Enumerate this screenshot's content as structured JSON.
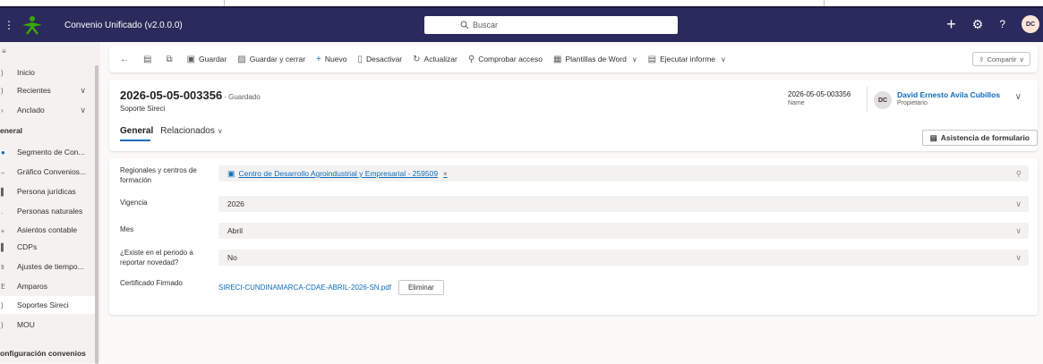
{
  "app": {
    "title": "Convenio Unificado (v2.0.0.0)",
    "search_placeholder": "Buscar",
    "avatar_initials": "DC",
    "colors": {
      "topbar": "#2b2a5c",
      "accent": "#0f6cbd"
    }
  },
  "sidebar": {
    "items": [
      {
        "label": "Inicio"
      },
      {
        "label": "Recientes"
      },
      {
        "label": "Anclado"
      },
      {
        "label": "eneral"
      },
      {
        "label": "Segmento de Con..."
      },
      {
        "label": "Gráfico Convenios..."
      },
      {
        "label": "Persona jurídicas"
      },
      {
        "label": "Personas naturales"
      },
      {
        "label": "Asientos contable"
      },
      {
        "label": "CDPs"
      },
      {
        "label": "Ajustes de tiempo..."
      },
      {
        "label": "Amparos"
      },
      {
        "label": "Soportes Sireci"
      },
      {
        "label": "MOU"
      },
      {
        "label": "onfiguración convenios"
      }
    ]
  },
  "commands": {
    "save": "Guardar",
    "save_close": "Guardar y cerrar",
    "new": "Nuevo",
    "deactivate": "Desactivar",
    "refresh": "Actualizar",
    "check_access": "Comprobar acceso",
    "word_templates": "Plantillas de Word",
    "run_report": "Ejecutar informe",
    "share": "Compartir"
  },
  "record": {
    "title": "2026-05-05-003356",
    "status": "- Guardado",
    "entity": "Soporte Sireci",
    "name_value": "2026-05-05-003356",
    "name_label": "Name",
    "owner_initials": "DC",
    "owner_name": "David Ernesto Avila Cubillos",
    "owner_label": "Propietario"
  },
  "tabs": {
    "general": "General",
    "related": "Relacionados"
  },
  "assist_button": "Asistencia de formulario",
  "form": {
    "regional_label": "Regionales y centros de formación",
    "regional_value": "Centro de Desarrollo Agroindustrial y Empresarial - 259509",
    "vigencia_label": "Vigencia",
    "vigencia_value": "2026",
    "mes_label": "Mes",
    "mes_value": "Abril",
    "novedad_label": "¿Existe en el periodo a reportar novedad?",
    "novedad_value": "No",
    "cert_label": "Certificado Firmado",
    "cert_file": "SIRECI-CUNDINAMARCA-CDAE-ABRIL-2026-SN.pdf",
    "delete_button": "Eliminar"
  }
}
